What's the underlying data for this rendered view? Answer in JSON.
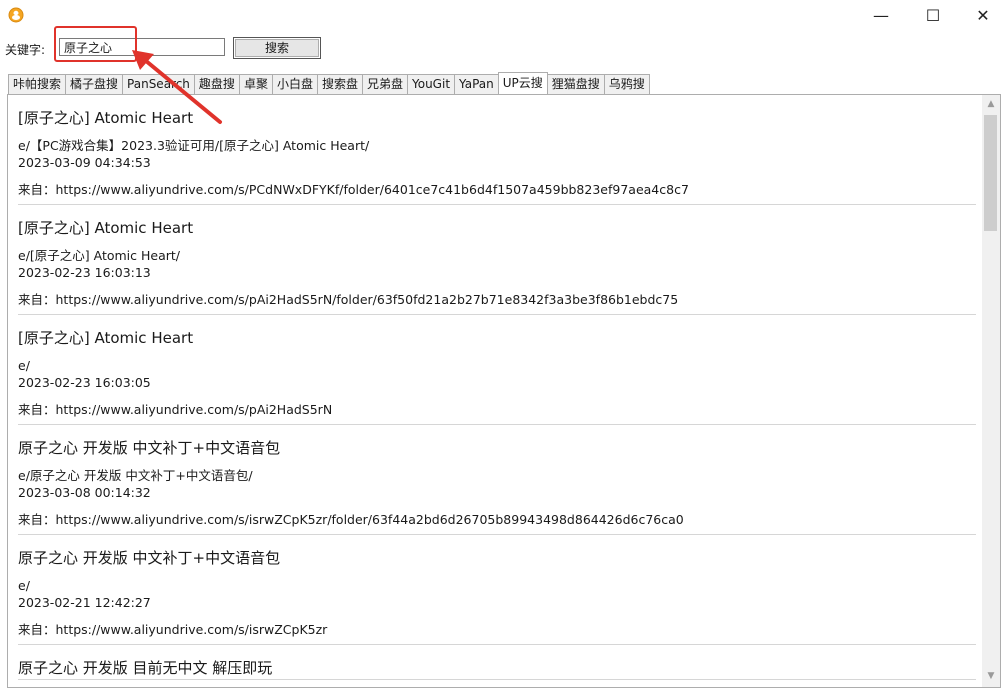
{
  "window": {
    "minimize_glyph": "—",
    "maximize_glyph": "☐",
    "close_glyph": "✕"
  },
  "search": {
    "label": "关键字:",
    "value": "原子之心",
    "button_label": "搜索"
  },
  "tabs": [
    {
      "label": "咔帕搜索",
      "active": false
    },
    {
      "label": "橘子盘搜",
      "active": false
    },
    {
      "label": "PanSearch",
      "active": false
    },
    {
      "label": "趣盘搜",
      "active": false
    },
    {
      "label": "卓聚",
      "active": false
    },
    {
      "label": "小白盘",
      "active": false
    },
    {
      "label": "搜索盘",
      "active": false
    },
    {
      "label": "兄弟盘",
      "active": false
    },
    {
      "label": "YouGit",
      "active": false
    },
    {
      "label": "YaPan",
      "active": false
    },
    {
      "label": "UP云搜",
      "active": true
    },
    {
      "label": "狸猫盘搜",
      "active": false
    },
    {
      "label": "乌鸦搜",
      "active": false
    }
  ],
  "results": [
    {
      "title": "[原子之心] Atomic Heart",
      "path": "e/【PC游戏合集】2023.3验证可用/[原子之心] Atomic Heart/",
      "date": "2023-03-09 04:34:53",
      "source": "来自：https://www.aliyundrive.com/s/PCdNWxDFYKf/folder/6401ce7c41b6d4f1507a459bb823ef97aea4c8c7"
    },
    {
      "title": "[原子之心] Atomic Heart",
      "path": "e/[原子之心] Atomic Heart/",
      "date": "2023-02-23 16:03:13",
      "source": "来自：https://www.aliyundrive.com/s/pAi2HadS5rN/folder/63f50fd21a2b27b71e8342f3a3be3f86b1ebdc75"
    },
    {
      "title": "[原子之心] Atomic Heart",
      "path": "e/",
      "date": "2023-02-23 16:03:05",
      "source": "来自：https://www.aliyundrive.com/s/pAi2HadS5rN"
    },
    {
      "title": "原子之心 开发版 中文补丁+中文语音包",
      "path": "e/原子之心 开发版 中文补丁+中文语音包/",
      "date": "2023-03-08 00:14:32",
      "source": "来自：https://www.aliyundrive.com/s/isrwZCpK5zr/folder/63f44a2bd6d26705b89943498d864426d6c76ca0"
    },
    {
      "title": "原子之心 开发版 中文补丁+中文语音包",
      "path": "e/",
      "date": "2023-02-21 12:42:27",
      "source": "来自：https://www.aliyundrive.com/s/isrwZCpK5zr"
    },
    {
      "title": "原子之心 开发版 目前无中文 解压即玩",
      "path": "",
      "date": "",
      "source": ""
    }
  ],
  "colors": {
    "annotation_red": "#e0332b",
    "app_icon": "#f5a623"
  },
  "icons": {
    "app": "app-icon",
    "scroll_up": "chevron-up-icon",
    "scroll_down": "chevron-down-icon"
  }
}
